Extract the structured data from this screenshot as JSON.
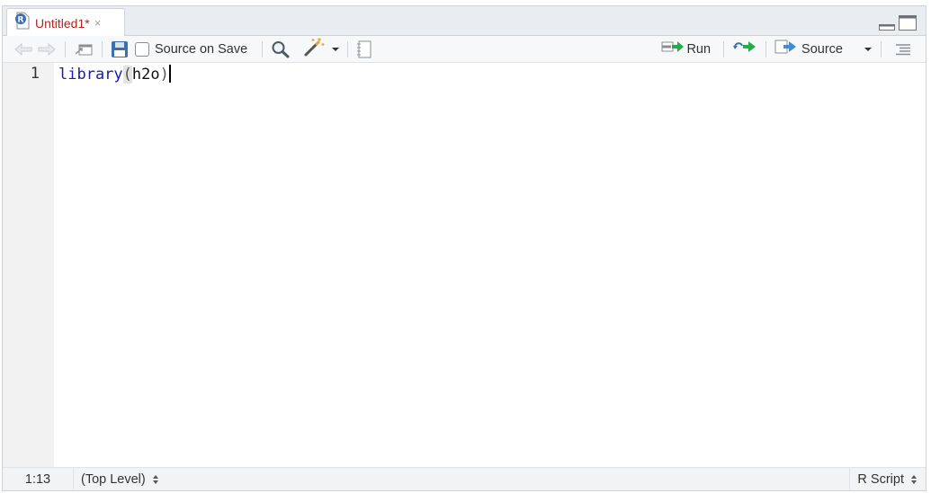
{
  "tab": {
    "title": "Untitled1*",
    "close": "×"
  },
  "toolbar": {
    "source_on_save": "Source on Save",
    "run": "Run",
    "source": "Source"
  },
  "editor": {
    "line_number": "1",
    "code": {
      "function": "library",
      "open_paren": "(",
      "argument": "h2o",
      "close_paren": ")"
    }
  },
  "status": {
    "position": "1:13",
    "scope": "(Top Level)",
    "file_type": "R Script"
  },
  "colors": {
    "tab_title": "#b2241c",
    "keyword": "#1a1aa6",
    "run_arrow": "#2aa84a",
    "save_icon": "#3a6fb0"
  },
  "icons": [
    "r-file-icon",
    "back-arrow-icon",
    "forward-arrow-icon",
    "show-in-window-icon",
    "save-icon",
    "search-icon",
    "magic-wand-icon",
    "compile-report-icon",
    "run-arrow-icon",
    "rerun-icon",
    "source-arrow-icon",
    "outline-icon",
    "minimize-icon",
    "maximize-icon"
  ]
}
